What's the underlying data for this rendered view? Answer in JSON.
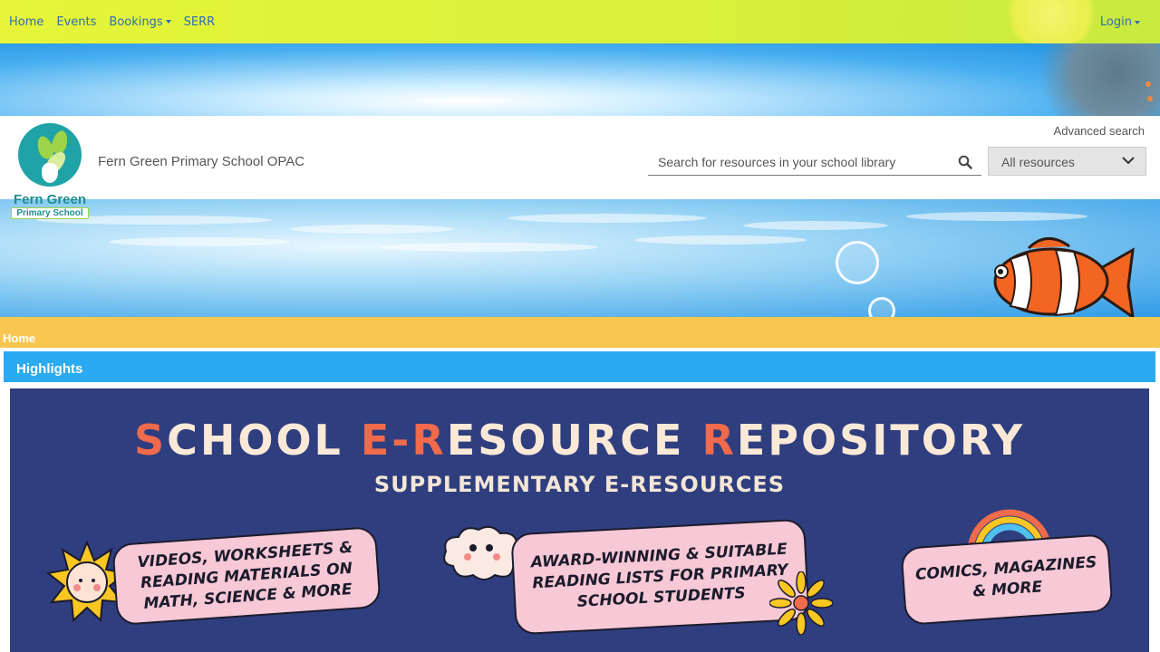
{
  "nav": {
    "items": [
      {
        "label": "Home"
      },
      {
        "label": "Events"
      },
      {
        "label": "Bookings",
        "dropdown": true
      },
      {
        "label": "SERR"
      }
    ],
    "login_label": "Login"
  },
  "header": {
    "logo": {
      "line1": "Fern Green",
      "line2": "Primary School"
    },
    "site_title": "Fern Green Primary School OPAC",
    "advanced_search": "Advanced search",
    "search": {
      "placeholder": "Search for resources in your school library",
      "value": ""
    },
    "resource_filter": {
      "selected": "All resources"
    }
  },
  "breadcrumb": {
    "home": "Home"
  },
  "highlights": {
    "title": "Highlights",
    "promo": {
      "title_parts": [
        {
          "text": "S",
          "accent": true
        },
        {
          "text": "CHOOL ",
          "accent": false
        },
        {
          "text": "E-R",
          "accent": true
        },
        {
          "text": "ESOURCE ",
          "accent": false
        },
        {
          "text": "R",
          "accent": true
        },
        {
          "text": "EPOSITORY",
          "accent": false
        }
      ],
      "subtitle": "SUPPLEMENTARY E-RESOURCES",
      "pills": [
        {
          "line1": "VIDEOS, WORKSHEETS &",
          "line2": "READING MATERIALS ON",
          "line3": "MATH, SCIENCE & MORE"
        },
        {
          "line1": "AWARD-WINNING & SUITABLE",
          "line2": "READING LISTS FOR PRIMARY",
          "line3": "SCHOOL STUDENTS"
        },
        {
          "line1": "COMICS, MAGAZINES",
          "line2": "& MORE"
        }
      ]
    }
  },
  "colors": {
    "nav_bg": "#e6f53a",
    "link": "#2f6fa8",
    "breadcrumb_bg": "#f9c650",
    "highlights_bg": "#29aaf1",
    "promo_bg": "#2f3e7e",
    "promo_accent": "#f06a4c",
    "pill_bg": "#f7c8d6"
  }
}
